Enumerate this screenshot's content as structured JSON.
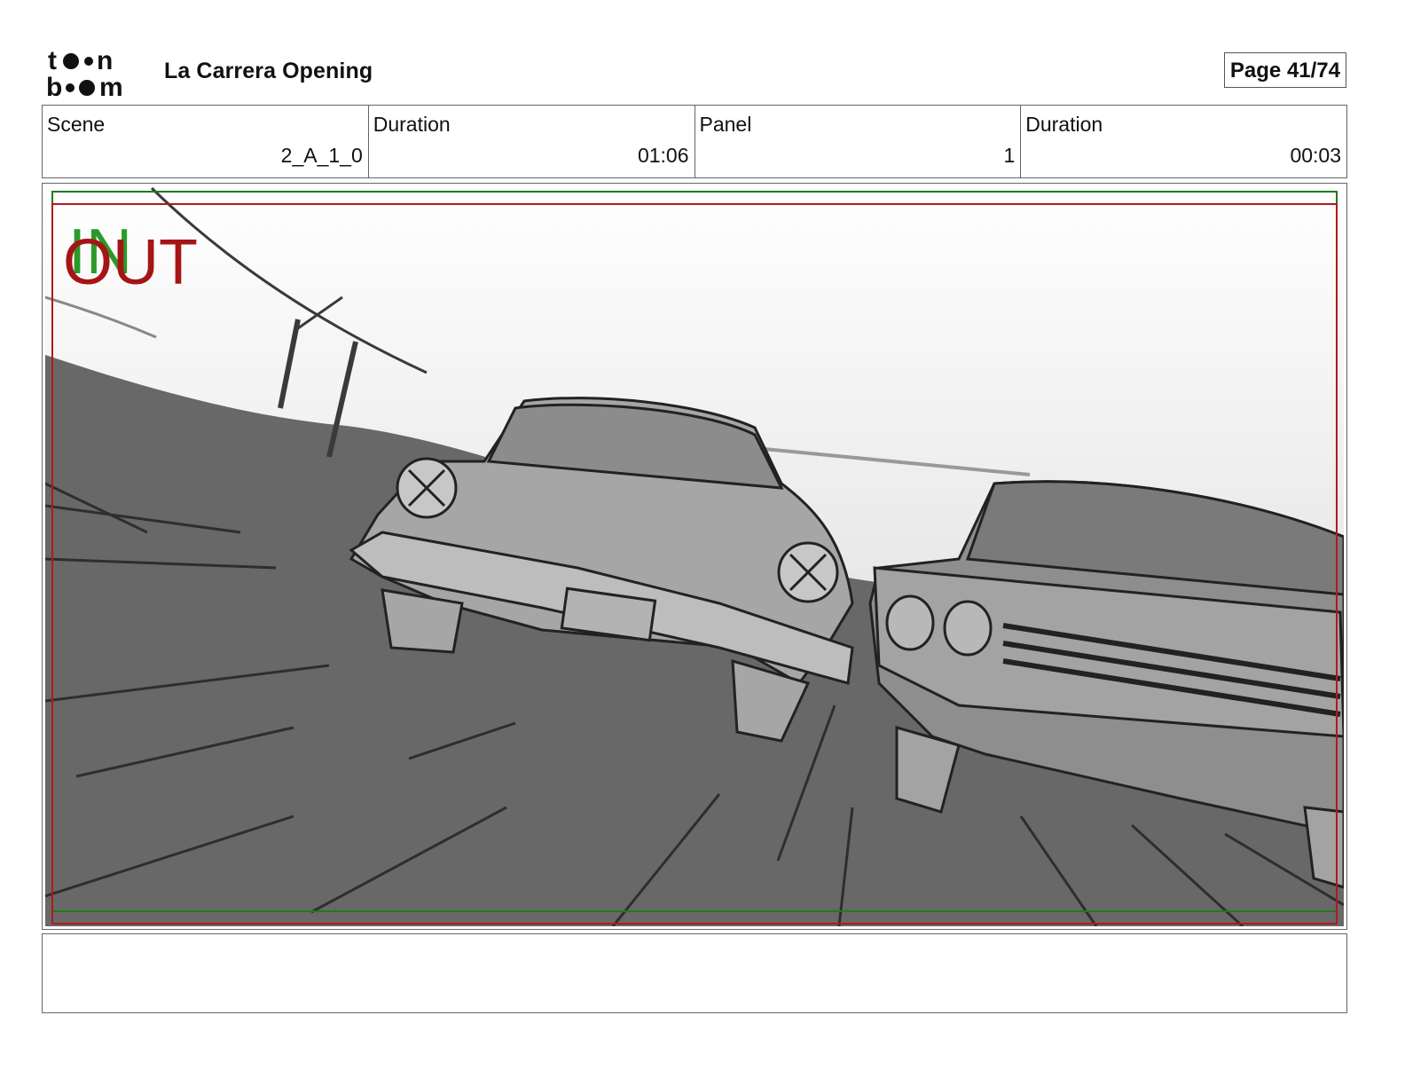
{
  "header": {
    "logo_text": "toon boom",
    "title": "La Carrera Opening",
    "page": "Page 41/74"
  },
  "info": [
    {
      "label": "Scene",
      "value": "2_A_1_0"
    },
    {
      "label": "Duration",
      "value": "01:06"
    },
    {
      "label": "Panel",
      "value": "1"
    },
    {
      "label": "Duration",
      "value": "00:03"
    }
  ],
  "panel": {
    "in_marker": "IN",
    "out_marker": "OUT",
    "in_color": "#2a9a2a",
    "out_color": "#a51515",
    "image_description_icon": "storyboard-sketch-cars-racing"
  },
  "notes": {
    "text": ""
  }
}
